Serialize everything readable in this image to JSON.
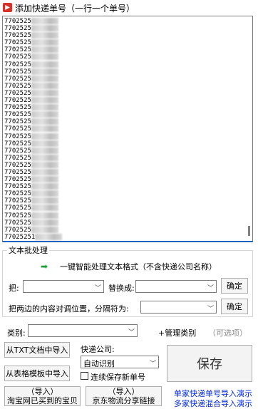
{
  "window": {
    "title": "添加快递单号（一行一个单号）"
  },
  "numbers": {
    "prefix": "7702525",
    "lines": [
      "7702525",
      "7702525",
      "7702525",
      "7702525",
      "7702525",
      "7702525",
      "7702525",
      "7702525",
      "7702525",
      "7702525",
      "7702525",
      "7702525",
      "7702525",
      "7702525",
      "7702525",
      "7702525",
      "7702525",
      "7702525",
      "7702525",
      "7702525",
      "7702525",
      "7702525",
      "7702525",
      "7702525",
      "7702525",
      "7702525",
      "7702525",
      "7702525",
      "7702525",
      "7702525"
    ],
    "last_line": "77025251"
  },
  "text_processing": {
    "legend": "文本批处理",
    "smart_button": "一键智能处理文本格式（不含快递公司名称）",
    "replace_from_label": "把:",
    "replace_to_label": "替换成:",
    "confirm1": "确定",
    "swap_label": "把两边的内容对调位置，分隔符为:",
    "confirm2": "确定"
  },
  "category": {
    "label": "类别:",
    "manage": "+管理类别",
    "hint": "（可选项）"
  },
  "import": {
    "txt_button": "从TXT文档中导入",
    "excel_button": "从表格模板中导入",
    "taobao_button_line1": "（导入）",
    "taobao_button_line2": "淘宝网已买到的宝贝",
    "jd_button_line1": "（导入）",
    "jd_button_line2": "京东物流分享链接"
  },
  "courier": {
    "label": "快递公司:",
    "selected": "自动识别",
    "continuous_save": "连续保存新单号"
  },
  "save_button": "保存",
  "links": {
    "single": "单家快递单号导入演示",
    "multi": "多家快递混合导入演示"
  }
}
